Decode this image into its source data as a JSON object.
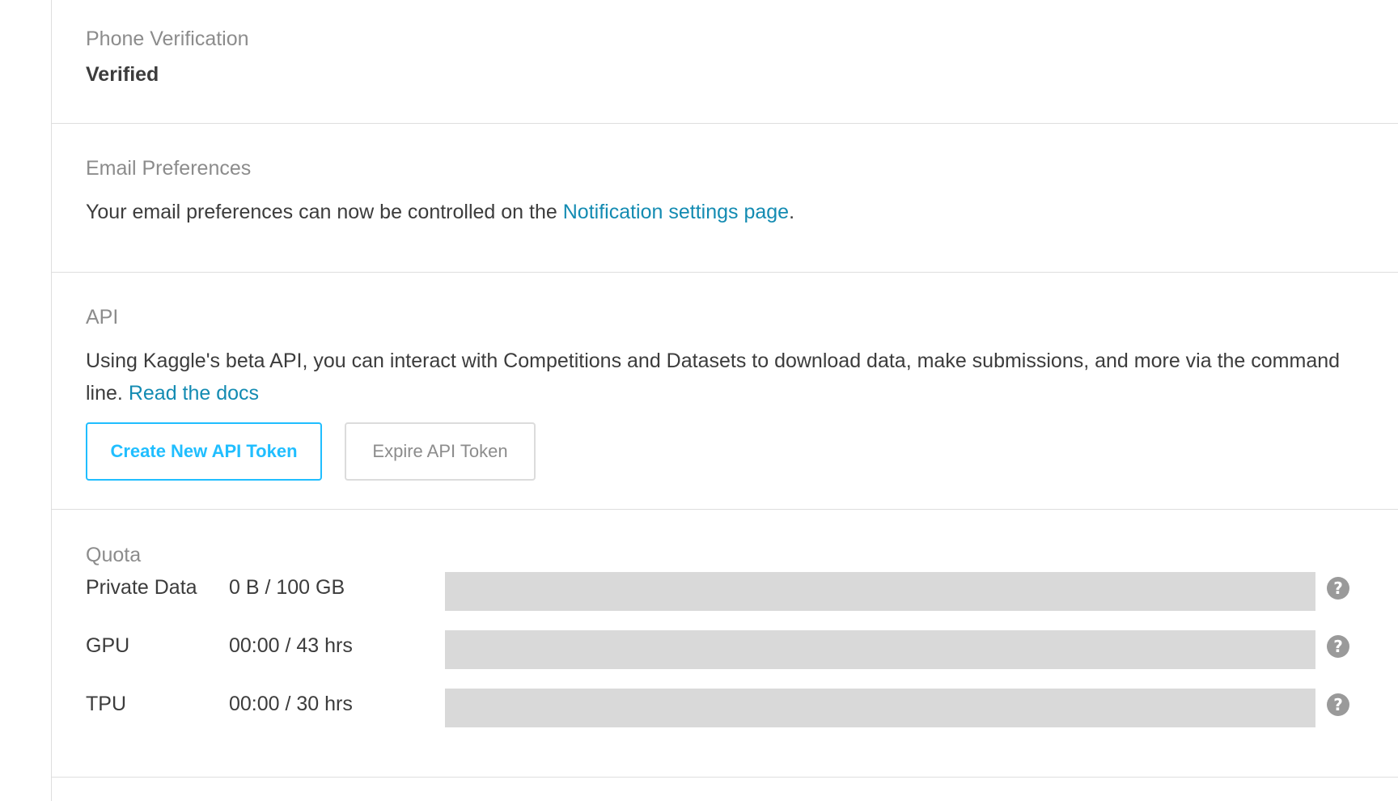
{
  "phone_verification": {
    "label": "Phone Verification",
    "value": "Verified"
  },
  "email_preferences": {
    "label": "Email Preferences",
    "text_before_link": "Your email preferences can now be controlled on the ",
    "link_text": "Notification settings page",
    "text_after_link": "."
  },
  "api": {
    "label": "API",
    "description": "Using Kaggle's beta API, you can interact with Competitions and Datasets to download data, make submissions, and more via the command line.",
    "docs_link_text": "Read the docs",
    "create_token_label": "Create New API Token",
    "expire_token_label": "Expire API Token"
  },
  "quota": {
    "label": "Quota",
    "rows": [
      {
        "name": "Private Data",
        "usage": "0 B / 100 GB",
        "fill_fraction": 0,
        "help_icon": "question-circle-icon"
      },
      {
        "name": "GPU",
        "usage": "00:00 / 43 hrs",
        "fill_fraction": 0,
        "help_icon": "question-circle-icon"
      },
      {
        "name": "TPU",
        "usage": "00:00 / 30 hrs",
        "fill_fraction": 0,
        "help_icon": "question-circle-icon"
      }
    ]
  },
  "colors": {
    "link": "#138bb2",
    "primary_button": "#20beff",
    "label_gray": "#8c8c8c",
    "text": "#3c3c3c",
    "quota_track": "#d9d9d9",
    "divider": "#dedede"
  }
}
